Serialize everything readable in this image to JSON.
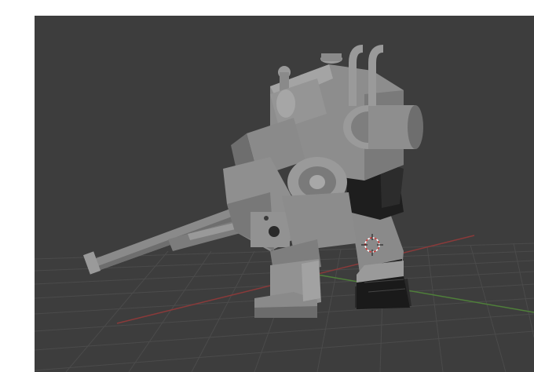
{
  "viewport": {
    "background": "#3d3d3d",
    "grid_color": "#4a4a4a",
    "x_axis_color": "#8a3a3a",
    "y_axis_color": "#5a8a3a",
    "object": "mech-robot-model",
    "object_color": "#8c8c8c",
    "object_shadow": "#6a6a6a",
    "object_dark": "#1e1e1e",
    "cursor": "3d-cursor-icon"
  }
}
